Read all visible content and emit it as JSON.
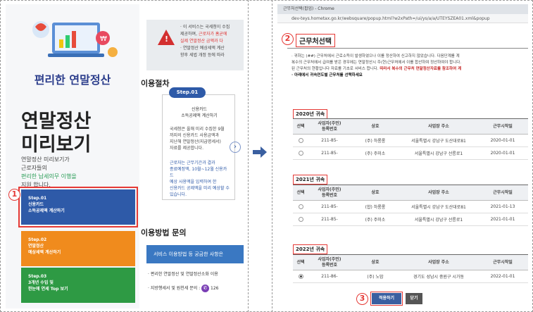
{
  "left": {
    "brand": "편리한 연말정산",
    "big_title_1": "연말정산",
    "big_title_2": "미리보기",
    "desc_1": "연말정산 미리보기가",
    "desc_2": "근로자들의",
    "desc_3_hl": "편리한 납세의무 이행을",
    "desc_4": "지원 합니다.",
    "steps": [
      {
        "line1": "Step.01",
        "line2": "신용카드",
        "line3": "소득공제액 계산하기"
      },
      {
        "line1": "Step.02",
        "line2": "연말정산",
        "line3": "예상세액 계산하기"
      },
      {
        "line1": "Step.03",
        "line2": "3개년 수입 및",
        "line3": "한눈에 연세 Top 보기"
      }
    ],
    "notice_1": "· 이 서비스는 국세청이 수집",
    "notice_2": "제공하며,",
    "notice_2_red": "근로자가 홈균에",
    "notice_3_red": "실제 연말정산 금액과 다",
    "notice_4": "· 연말정산 예상세액 계산",
    "notice_5": "향후 세법 개정 등에 따라",
    "usage_title": "이용절차",
    "step_pill": "Step.01",
    "card_title_1": "신용카드",
    "card_title_2": "소득공제액 계산하기",
    "card_p1": [
      "국세청은 올해 미리 수집한 9월",
      "까지의 신용카드 사용금액과",
      "지난해 연말정산(지급명세서)",
      "자료를 제공합니다."
    ],
    "card_p2": [
      "근로자는 근무기간과 결과",
      "종료예정액, 10월~12월 신용카드",
      "예상 사용액을 입력하여 한",
      "신용카드 공제액을 미리 예상할 수",
      "있습니다."
    ],
    "next_icon": "chevron-right",
    "inquiry_title": "이용방법 문의",
    "cs_banner": "서비스 이용방법 등 궁금한 사항은",
    "cs_item_1": "· 편리한 연말정산 및 연말정산소화 이용",
    "cs_item_2": "· 지방행세서 및 원천세 문의 :",
    "cs_phone": "126",
    "badge": "1"
  },
  "right": {
    "window_title": "근무처선택(팝업) - Chrome",
    "url": "dev-teys.hometax.go.kr/websquare/popup.html?w2xPath=/ui/ys/a/a/UTEYSZEA01.xml&popup",
    "popup_title": "근무처선택",
    "badge_2": "2",
    "intro_1": "· 귀하는 (##) 근무처에서 근로소득이 발생하였으나 이를 정산하여 신고하지 않았습니다. 다음단계를 계",
    "intro_2": "복수의 근무처에서 급여를 받은 경우에는 연말정산시 주(현)근무처에서 이를 합산하여 정산하여야 합니다.",
    "intro_3": "된 근무처의 현황입니다 자료를 기초로 서비스 합니다.",
    "intro_3_red": "따라서 복수의 근무처 연말정산자료를 참조하여 계",
    "intro_4": "· 아래에서 귀속연도별 근무처를 선택하세요",
    "columns": [
      "선택",
      "사업자(주민)\n등록번호",
      "상호",
      "사업장 주소",
      "근무시작일"
    ],
    "years": [
      {
        "tag": "2020년 귀속",
        "rows": [
          {
            "id": "211-85-",
            "name": "(주) 하롱롱",
            "addr": "서울특별시 강남구 도산대로81",
            "date": "2020-01-01",
            "checked": false
          },
          {
            "id": "211-85-",
            "name": "(주) 주미소",
            "addr": "서울특별시 강남구 선릉로1",
            "date": "2020-01-01",
            "checked": false
          }
        ]
      },
      {
        "tag": "2021년 귀속",
        "rows": [
          {
            "id": "211-85-",
            "name": "(합) 하롱롱",
            "addr": "서울특별시 강남구 도산대로81",
            "date": "2021-01-13",
            "checked": false
          },
          {
            "id": "211-85-",
            "name": "(주) 주미소",
            "addr": "서울특별시 강남구 선릉로1",
            "date": "2021-01-01",
            "checked": false
          }
        ]
      },
      {
        "tag": "2022년 귀속",
        "rows": [
          {
            "id": "211-86-",
            "name": "(주) 노맘",
            "addr": "경기도 성남시 중원구 시가동",
            "date": "2022-01-01",
            "checked": true
          }
        ]
      }
    ],
    "badge_3": "3",
    "confirm_label": "적용하기",
    "close_label": "닫기"
  },
  "colors": {
    "accent_blue": "#2e5aa8",
    "highlight_red": "#e53935",
    "orange": "#f08b1d",
    "green": "#2e9a44"
  }
}
